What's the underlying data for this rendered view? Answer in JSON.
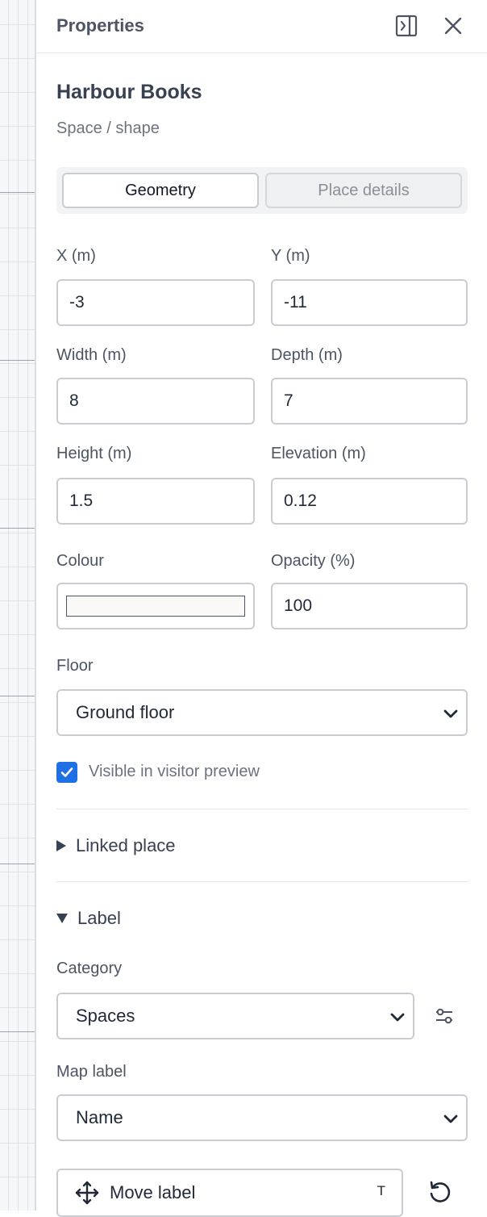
{
  "header": {
    "title": "Properties"
  },
  "place": {
    "name": "Harbour Books",
    "type": "Space / shape"
  },
  "tabs": [
    {
      "label": "Geometry",
      "active": true
    },
    {
      "label": "Place details",
      "active": false
    }
  ],
  "fields": {
    "x": {
      "label": "X (m)",
      "value": "-3"
    },
    "y": {
      "label": "Y (m)",
      "value": "-11"
    },
    "width": {
      "label": "Width (m)",
      "value": "8"
    },
    "depth": {
      "label": "Depth (m)",
      "value": "7"
    },
    "height": {
      "label": "Height (m)",
      "value": "1.5"
    },
    "elevation": {
      "label": "Elevation (m)",
      "value": "0.12"
    },
    "colour": {
      "label": "Colour",
      "value": "#faf9f6"
    },
    "opacity": {
      "label": "Opacity (%)",
      "value": "100"
    }
  },
  "floor": {
    "label": "Floor",
    "selected": "Ground floor"
  },
  "visible_preview": {
    "label": "Visible in visitor preview",
    "checked": true
  },
  "sections": {
    "linked_place": {
      "label": "Linked place",
      "expanded": false
    },
    "label": {
      "label": "Label",
      "expanded": true
    }
  },
  "label_section": {
    "category": {
      "label": "Category",
      "selected": "Spaces"
    },
    "map_label": {
      "label": "Map label",
      "selected": "Name"
    },
    "move_label": {
      "label": "Move label",
      "shortcut": "T"
    }
  },
  "colors": {
    "accent": "#1f6fe5",
    "border": "#c9cdd3"
  }
}
